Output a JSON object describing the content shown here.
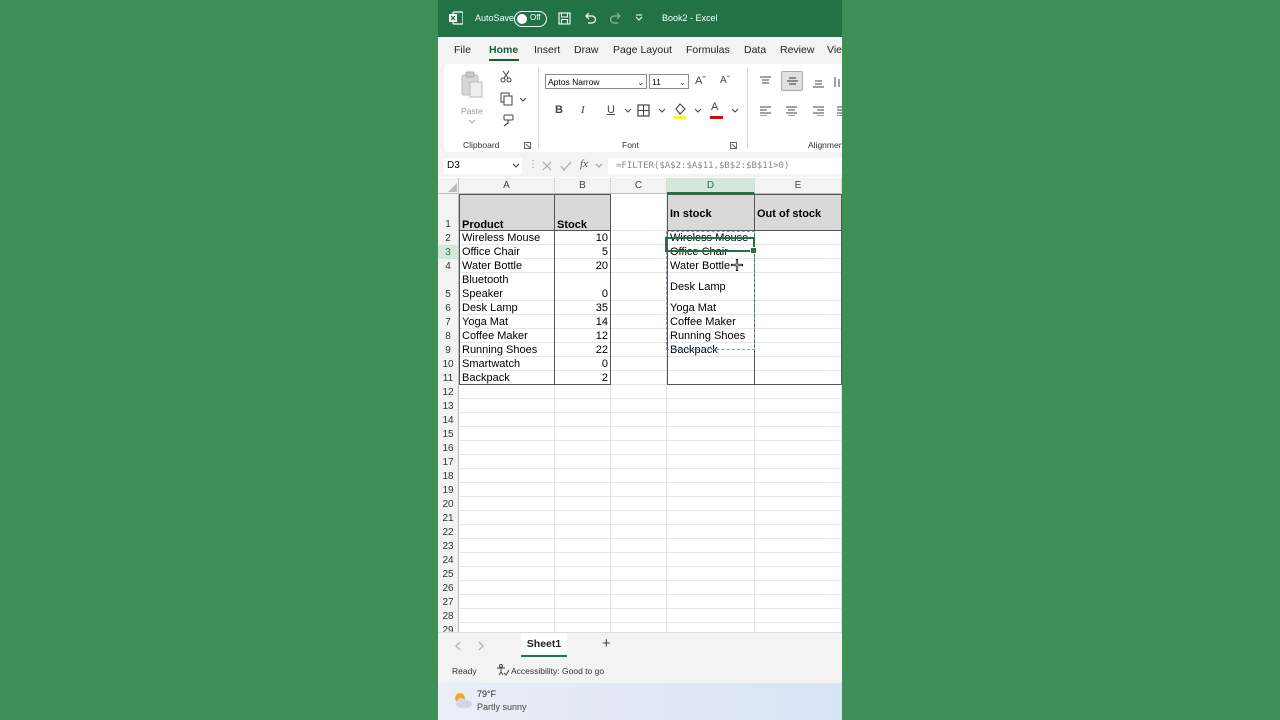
{
  "titlebar": {
    "autosave_label": "AutoSave",
    "autosave_state": "Off",
    "document_title": "Book2  -  Excel"
  },
  "ribbon_tabs": [
    "File",
    "Home",
    "Insert",
    "Draw",
    "Page Layout",
    "Formulas",
    "Data",
    "Review",
    "Vie"
  ],
  "ribbon": {
    "paste_label": "Paste",
    "font_name": "Aptos Narrow",
    "font_size": "11",
    "group_clipboard": "Clipboard",
    "group_font": "Font",
    "group_alignment": "Alignmen",
    "bold": "B",
    "italic": "I",
    "underline": "U",
    "font_color_letter": "A",
    "grow_font": "Aˆ",
    "shrink_font": "Aˇ"
  },
  "formula_bar": {
    "name_box": "D3",
    "fx": "fx",
    "formula": "=FILTER($A$2:$A$11,$B$2:$B$11>0)"
  },
  "columns": [
    "A",
    "B",
    "C",
    "D",
    "E"
  ],
  "rows": [
    "1",
    "2",
    "3",
    "4",
    "5",
    "6",
    "7",
    "8",
    "9",
    "10",
    "11",
    "12",
    "13",
    "14",
    "15",
    "16",
    "17",
    "18",
    "19",
    "20",
    "21",
    "22",
    "23",
    "24",
    "25",
    "26",
    "27",
    "28",
    "29"
  ],
  "table": {
    "headers": [
      "Product",
      "Stock"
    ],
    "rows": [
      {
        "product_1": "Wireless Mouse",
        "stock": "10"
      },
      {
        "product_1": "Office Chair",
        "stock": "5"
      },
      {
        "product_1": "Water Bottle",
        "stock": "20"
      },
      {
        "product_1": "Bluetooth",
        "product_2": "Speaker",
        "stock": "0"
      },
      {
        "product_1": "Desk Lamp",
        "stock": "35"
      },
      {
        "product_1": "Yoga Mat",
        "stock": "14"
      },
      {
        "product_1": "Coffee Maker",
        "stock": "12"
      },
      {
        "product_1": "Running Shoes",
        "stock": "22"
      },
      {
        "product_1": "Smartwatch",
        "stock": "0"
      },
      {
        "product_1": "Backpack",
        "stock": "2"
      }
    ]
  },
  "output": {
    "headers": [
      "In stock",
      "Out of stock"
    ],
    "in_stock": [
      "Wireless Mouse",
      "Office Chair",
      "Water Bottle",
      "Desk Lamp",
      "Yoga Mat",
      "Coffee Maker",
      "Running Shoes",
      "Backpack"
    ]
  },
  "sheet_tabs": {
    "active": "Sheet1",
    "add": "+"
  },
  "status": {
    "ready": "Ready",
    "accessibility": "Accessibility: Good to go"
  },
  "weather": {
    "temp": "79°F",
    "condition": "Partly sunny"
  },
  "colors": {
    "excel_green": "#217346",
    "background": "#3f8f58"
  }
}
